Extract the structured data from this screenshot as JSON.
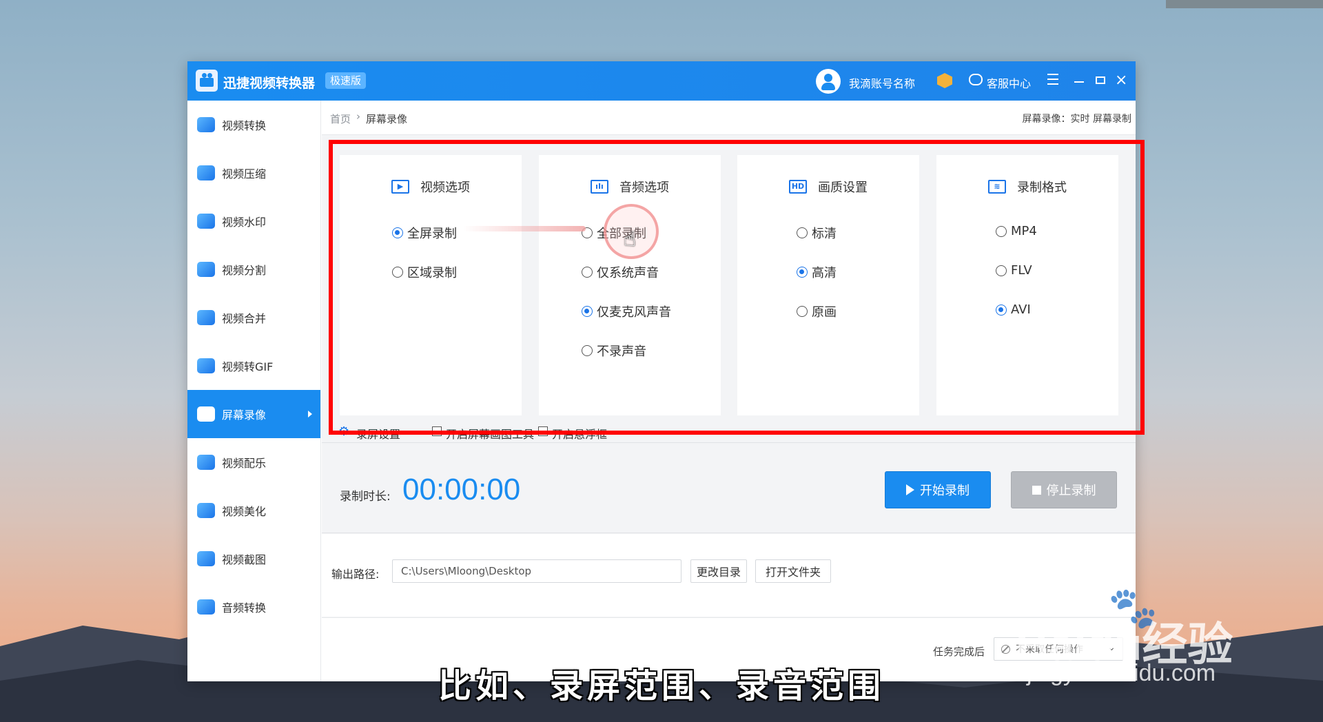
{
  "app": {
    "title": "迅捷视频转换器",
    "badge": "极速版",
    "account_name": "我滴账号名称",
    "service_center": "客服中心"
  },
  "sidebar": {
    "items": [
      {
        "label": "视频转换"
      },
      {
        "label": "视频压缩"
      },
      {
        "label": "视频水印"
      },
      {
        "label": "视频分割"
      },
      {
        "label": "视频合并"
      },
      {
        "label": "视频转GIF"
      },
      {
        "label": "屏幕录像",
        "active": true
      },
      {
        "label": "视频配乐"
      },
      {
        "label": "视频美化"
      },
      {
        "label": "视频截图"
      },
      {
        "label": "音频转换"
      }
    ]
  },
  "breadcrumb": {
    "home": "首页",
    "separator": "›",
    "current": "屏幕录像",
    "right_info": "屏幕录像：实时 屏幕录制"
  },
  "cards": {
    "video": {
      "title": "视频选项",
      "icon": "HD",
      "options": [
        "全屏录制",
        "区域录制"
      ],
      "selected": "全屏录制"
    },
    "audio": {
      "title": "音频选项",
      "options": [
        "全部录制",
        "仅系统声音",
        "仅麦克风声音",
        "不录声音"
      ],
      "selected": "仅麦克风声音"
    },
    "quality": {
      "title": "画质设置",
      "icon_text": "HD",
      "options": [
        "标清",
        "高清",
        "原画"
      ],
      "selected": "高清"
    },
    "format": {
      "title": "录制格式",
      "options": [
        "MP4",
        "FLV",
        "AVI"
      ],
      "selected": "AVI"
    }
  },
  "settings": {
    "record_settings": "录屏设置",
    "draw_tool": "开启屏幕画图工具",
    "floating_frame": "开启悬浮框"
  },
  "timer": {
    "label": "录制时长:",
    "value": "00:00:00",
    "start_label": "开始录制",
    "stop_label": "停止录制"
  },
  "output": {
    "label": "输出路径:",
    "path": "C:\\Users\\Mloong\\Desktop",
    "change_dir": "更改目录",
    "open_folder": "打开文件夹"
  },
  "footer": {
    "after_label": "任务完成后",
    "after_value": "不采取任何操作"
  },
  "overlay": {
    "subtitle": "比如、录屏范围、录音范围",
    "watermark_main": "Baidu经验",
    "watermark_sub": "jingyan.baidu.com"
  },
  "colors": {
    "accent": "#1a8cf0",
    "highlight_frame": "#ff0000",
    "stop_disabled": "#b7babf"
  }
}
